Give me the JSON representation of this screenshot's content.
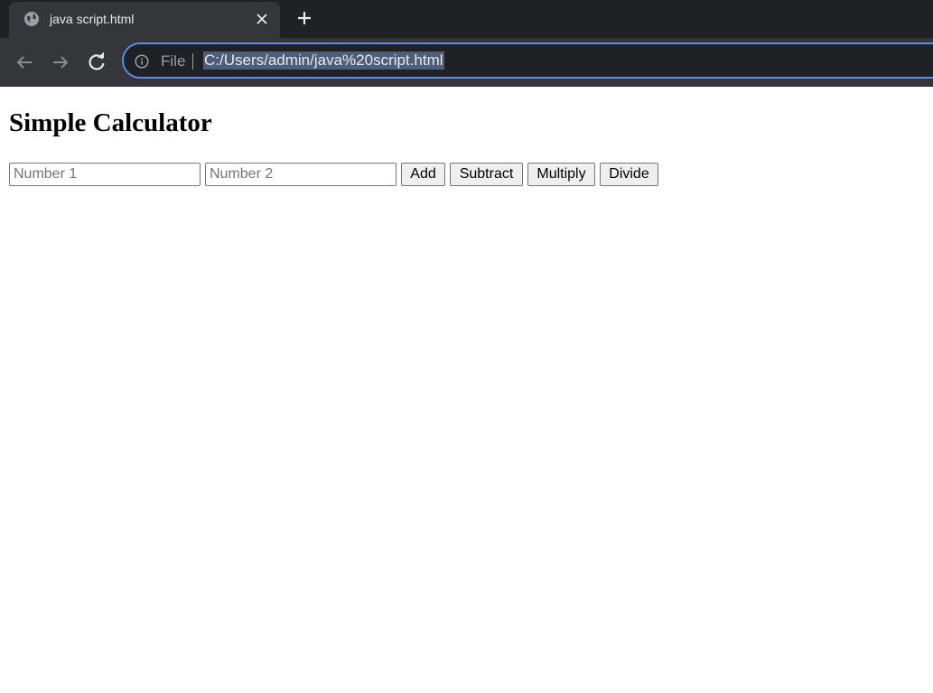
{
  "browser": {
    "tab": {
      "title": "java script.html",
      "favicon": "globe-icon"
    },
    "toolbar": {
      "scheme_label": "File",
      "url": "C:/Users/admin/java%20script.html"
    },
    "colors": {
      "chrome_dark": "#202124",
      "toolbar": "#35363a",
      "omnibox_border": "#5b8de6",
      "url_selection": "#4e5d78"
    }
  },
  "page": {
    "title": "Simple Calculator",
    "inputs": {
      "number1": {
        "value": "",
        "placeholder": "Number 1"
      },
      "number2": {
        "value": "",
        "placeholder": "Number 2"
      }
    },
    "buttons": {
      "add": "Add",
      "subtract": "Subtract",
      "multiply": "Multiply",
      "divide": "Divide"
    }
  }
}
